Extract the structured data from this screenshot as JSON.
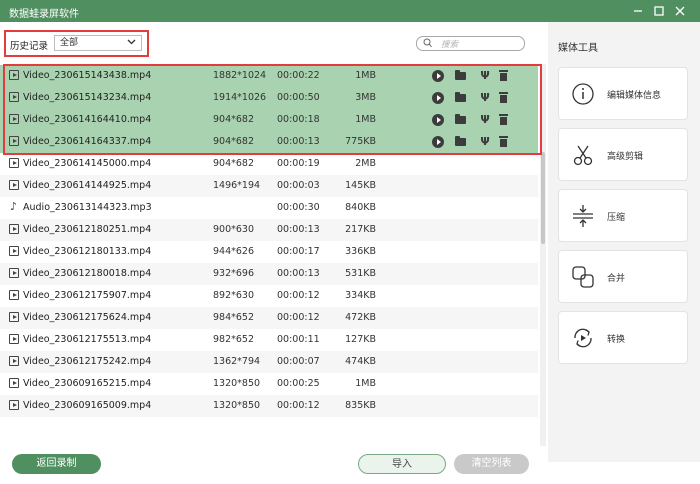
{
  "window": {
    "title": "数据蛙录屏软件"
  },
  "filter": {
    "history_label": "历史记录",
    "history_value": "全部",
    "search_placeholder": "搜索"
  },
  "files": [
    {
      "type": "video",
      "name": "Video_230615143438.mp4",
      "resolution": "1882*1024",
      "duration": "00:00:22",
      "size": "1MB",
      "highlighted": true
    },
    {
      "type": "video",
      "name": "Video_230615143234.mp4",
      "resolution": "1914*1026",
      "duration": "00:00:50",
      "size": "3MB",
      "highlighted": true
    },
    {
      "type": "video",
      "name": "Video_230614164410.mp4",
      "resolution": "904*682",
      "duration": "00:00:18",
      "size": "1MB",
      "highlighted": true
    },
    {
      "type": "video",
      "name": "Video_230614164337.mp4",
      "resolution": "904*682",
      "duration": "00:00:13",
      "size": "775KB",
      "highlighted": true
    },
    {
      "type": "video",
      "name": "Video_230614145000.mp4",
      "resolution": "904*682",
      "duration": "00:00:19",
      "size": "2MB",
      "highlighted": false
    },
    {
      "type": "video",
      "name": "Video_230614144925.mp4",
      "resolution": "1496*194",
      "duration": "00:00:03",
      "size": "145KB",
      "highlighted": false
    },
    {
      "type": "audio",
      "name": "Audio_230613144323.mp3",
      "resolution": "",
      "duration": "00:00:30",
      "size": "840KB",
      "highlighted": false
    },
    {
      "type": "video",
      "name": "Video_230612180251.mp4",
      "resolution": "900*630",
      "duration": "00:00:13",
      "size": "217KB",
      "highlighted": false
    },
    {
      "type": "video",
      "name": "Video_230612180133.mp4",
      "resolution": "944*626",
      "duration": "00:00:17",
      "size": "336KB",
      "highlighted": false
    },
    {
      "type": "video",
      "name": "Video_230612180018.mp4",
      "resolution": "932*696",
      "duration": "00:00:13",
      "size": "531KB",
      "highlighted": false
    },
    {
      "type": "video",
      "name": "Video_230612175907.mp4",
      "resolution": "892*630",
      "duration": "00:00:12",
      "size": "334KB",
      "highlighted": false
    },
    {
      "type": "video",
      "name": "Video_230612175624.mp4",
      "resolution": "984*652",
      "duration": "00:00:12",
      "size": "472KB",
      "highlighted": false
    },
    {
      "type": "video",
      "name": "Video_230612175513.mp4",
      "resolution": "982*652",
      "duration": "00:00:11",
      "size": "127KB",
      "highlighted": false
    },
    {
      "type": "video",
      "name": "Video_230612175242.mp4",
      "resolution": "1362*794",
      "duration": "00:00:07",
      "size": "474KB",
      "highlighted": false
    },
    {
      "type": "video",
      "name": "Video_230609165215.mp4",
      "resolution": "1320*850",
      "duration": "00:00:25",
      "size": "1MB",
      "highlighted": false
    },
    {
      "type": "video",
      "name": "Video_230609165009.mp4",
      "resolution": "1320*850",
      "duration": "00:00:12",
      "size": "835KB",
      "highlighted": false
    }
  ],
  "bottom": {
    "back_label": "返回录制",
    "import_label": "导入",
    "clear_label": "清空列表"
  },
  "tools": {
    "title": "媒体工具",
    "items": [
      {
        "label": "编辑媒体信息",
        "icon": "info-icon"
      },
      {
        "label": "高级剪辑",
        "icon": "scissors-icon"
      },
      {
        "label": "压缩",
        "icon": "compress-icon"
      },
      {
        "label": "合并",
        "icon": "merge-icon"
      },
      {
        "label": "转换",
        "icon": "convert-icon"
      }
    ]
  },
  "colors": {
    "accent": "#4f8f60",
    "highlight_row": "#a9d3b0",
    "annotation": "#e23c3c"
  }
}
